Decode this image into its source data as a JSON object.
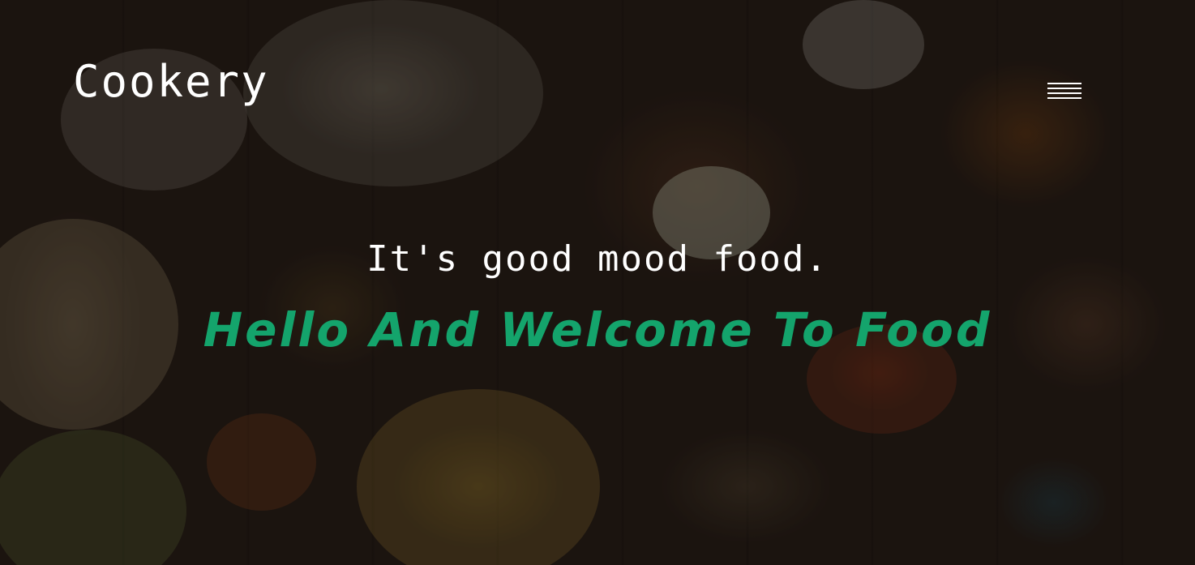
{
  "header": {
    "brand": "Cookery",
    "menu_icon": "hamburger-menu-icon"
  },
  "hero": {
    "tagline": "It's good mood food.",
    "headline": "Hello And Welcome To Food"
  },
  "colors": {
    "headline": "#14a46c",
    "text": "#ffffff"
  }
}
